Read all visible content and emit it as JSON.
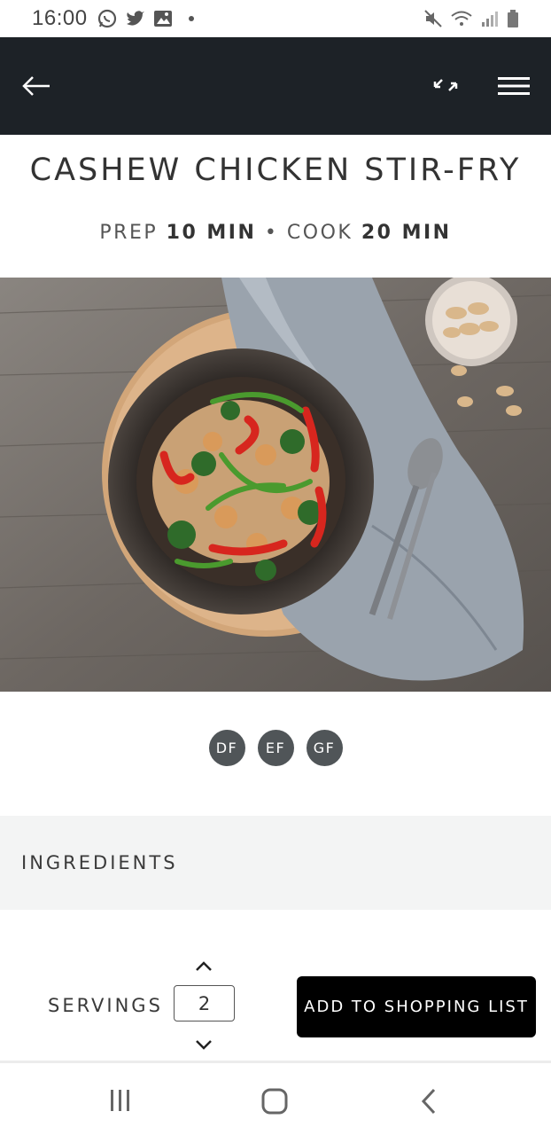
{
  "status_bar": {
    "time": "16:00",
    "left_icons": [
      "whatsapp-icon",
      "twitter-icon",
      "image-icon",
      "notification-dot"
    ],
    "right_icons": [
      "mute-icon",
      "wifi-icon",
      "signal-icon",
      "battery-icon"
    ]
  },
  "header": {
    "background": "#1d2227",
    "icons": [
      "back-arrow-icon",
      "collapse-expand-icon",
      "hamburger-menu-icon"
    ]
  },
  "recipe": {
    "title": "CASHEW CHICKEN STIR-FRY",
    "prep_label": "PREP",
    "prep_value": "10 MIN",
    "separator": "•",
    "cook_label": "COOK",
    "cook_value": "20 MIN"
  },
  "photo": {
    "subject": "stir-fry-bowl-photo"
  },
  "diet_badges": [
    "DF",
    "EF",
    "GF"
  ],
  "ingredients": {
    "heading": "INGREDIENTS"
  },
  "servings": {
    "label": "SERVINGS",
    "value": "2"
  },
  "actions": {
    "shopping_list": "ADD TO SHOPPING LIST"
  },
  "system_nav": {
    "icons": [
      "recent-apps-icon",
      "home-icon",
      "back-icon"
    ]
  }
}
